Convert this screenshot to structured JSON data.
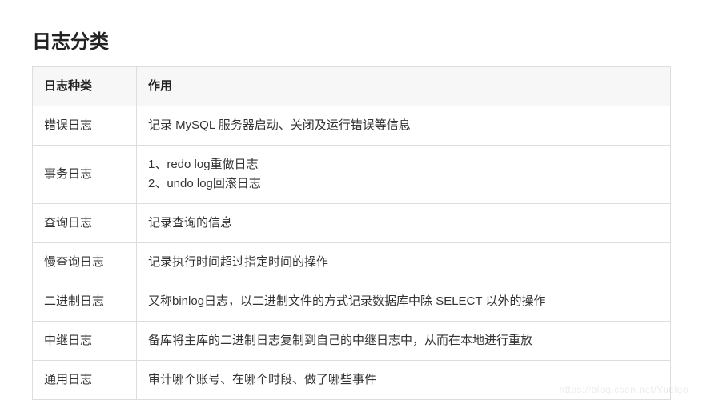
{
  "title": "日志分类",
  "headers": {
    "type": "日志种类",
    "usage": "作用"
  },
  "rows": [
    {
      "type": "错误日志",
      "usage": "记录 MySQL 服务器启动、关闭及运行错误等信息"
    },
    {
      "type": "事务日志",
      "usage_lines": [
        "1、redo log重做日志",
        "2、undo log回滚日志"
      ]
    },
    {
      "type": "查询日志",
      "usage": "记录查询的信息"
    },
    {
      "type": "慢查询日志",
      "usage": "记录执行时间超过指定时间的操作"
    },
    {
      "type": "二进制日志",
      "usage": "又称binlog日志，以二进制文件的方式记录数据库中除 SELECT 以外的操作"
    },
    {
      "type": "中继日志",
      "usage": "备库将主库的二进制日志复制到自己的中继日志中，从而在本地进行重放"
    },
    {
      "type": "通用日志",
      "usage": "审计哪个账号、在哪个时段、做了哪些事件"
    }
  ],
  "watermark": "https://blog.csdn.net/Yuolgo"
}
